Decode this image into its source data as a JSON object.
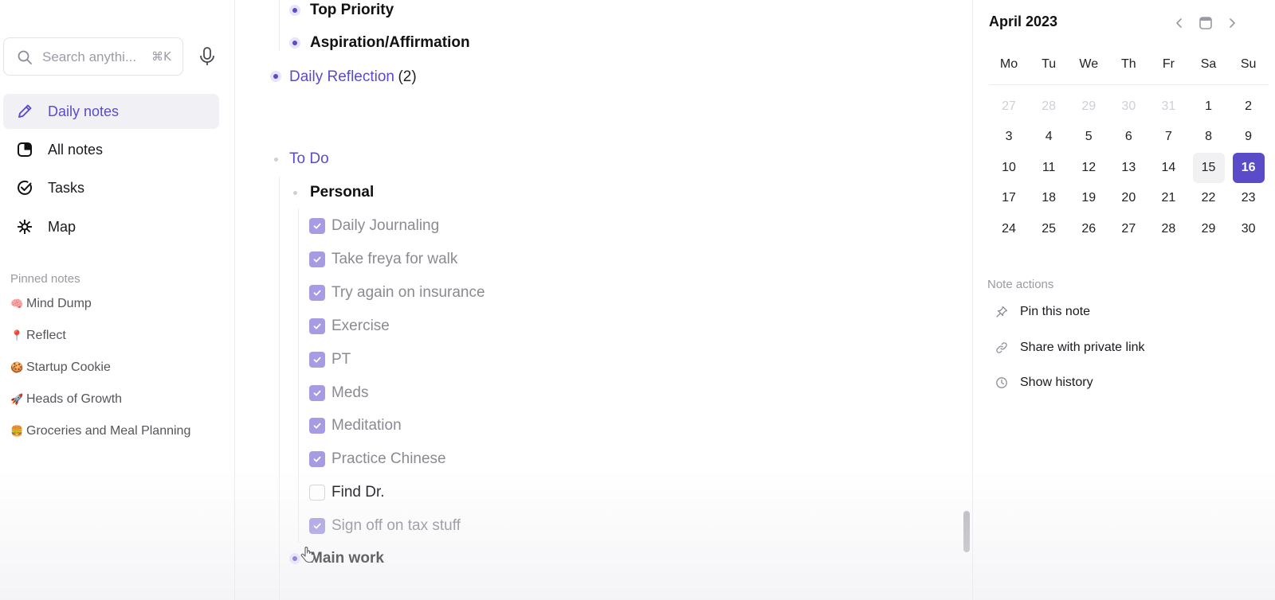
{
  "sidebar": {
    "search": {
      "placeholder": "Search anythi...",
      "shortcut": "⌘K"
    },
    "nav": [
      {
        "label": "Daily notes",
        "icon": "pencil-icon",
        "active": true
      },
      {
        "label": "All notes",
        "icon": "notes-icon",
        "active": false
      },
      {
        "label": "Tasks",
        "icon": "check-circle-icon",
        "active": false
      },
      {
        "label": "Map",
        "icon": "graph-icon",
        "active": false
      }
    ],
    "pinned_heading": "Pinned notes",
    "pinned": [
      {
        "emoji": "🧠",
        "label": "Mind Dump"
      },
      {
        "emoji": "📍",
        "label": "Reflect"
      },
      {
        "emoji": "🍪",
        "label": "Startup Cookie"
      },
      {
        "emoji": "🚀",
        "label": "Heads of Growth"
      },
      {
        "emoji": "🍔",
        "label": "Groceries and Meal Planning"
      }
    ]
  },
  "editor": {
    "top_priority": "Top Priority",
    "aspiration": "Aspiration/Affirmation",
    "daily_reflection": "Daily Reflection",
    "daily_reflection_count": "(2)",
    "todo": "To Do",
    "personal": "Personal",
    "tasks": [
      {
        "label": "Daily Journaling",
        "done": true
      },
      {
        "label": "Take freya for walk",
        "done": true
      },
      {
        "label": "Try again on insurance",
        "done": true
      },
      {
        "label": "Exercise",
        "done": true
      },
      {
        "label": "PT",
        "done": true
      },
      {
        "label": "Meds",
        "done": true
      },
      {
        "label": "Meditation",
        "done": true
      },
      {
        "label": "Practice Chinese",
        "done": true
      },
      {
        "label": "Find Dr.",
        "done": false
      },
      {
        "label": "Sign off on tax stuff",
        "done": true
      }
    ],
    "main_work": "Main work"
  },
  "calendar": {
    "month": "April 2023",
    "weekdays": [
      "Mo",
      "Tu",
      "We",
      "Th",
      "Fr",
      "Sa",
      "Su"
    ],
    "weeks": [
      [
        "27",
        "28",
        "29",
        "30",
        "31",
        "1",
        "2"
      ],
      [
        "3",
        "4",
        "5",
        "6",
        "7",
        "8",
        "9"
      ],
      [
        "10",
        "11",
        "12",
        "13",
        "14",
        "15",
        "16"
      ],
      [
        "17",
        "18",
        "19",
        "20",
        "21",
        "22",
        "23"
      ],
      [
        "24",
        "25",
        "26",
        "27",
        "28",
        "29",
        "30"
      ]
    ],
    "selected_day": "16",
    "hover_day": "15"
  },
  "note_actions": {
    "heading": "Note actions",
    "items": [
      {
        "label": "Pin this note",
        "icon": "pin-icon"
      },
      {
        "label": "Share with private link",
        "icon": "link-icon"
      },
      {
        "label": "Show history",
        "icon": "clock-icon"
      }
    ]
  },
  "colors": {
    "accent": "#5a4bc9",
    "checkbox": "#a59ce4",
    "muted_text": "#8a8a93"
  }
}
